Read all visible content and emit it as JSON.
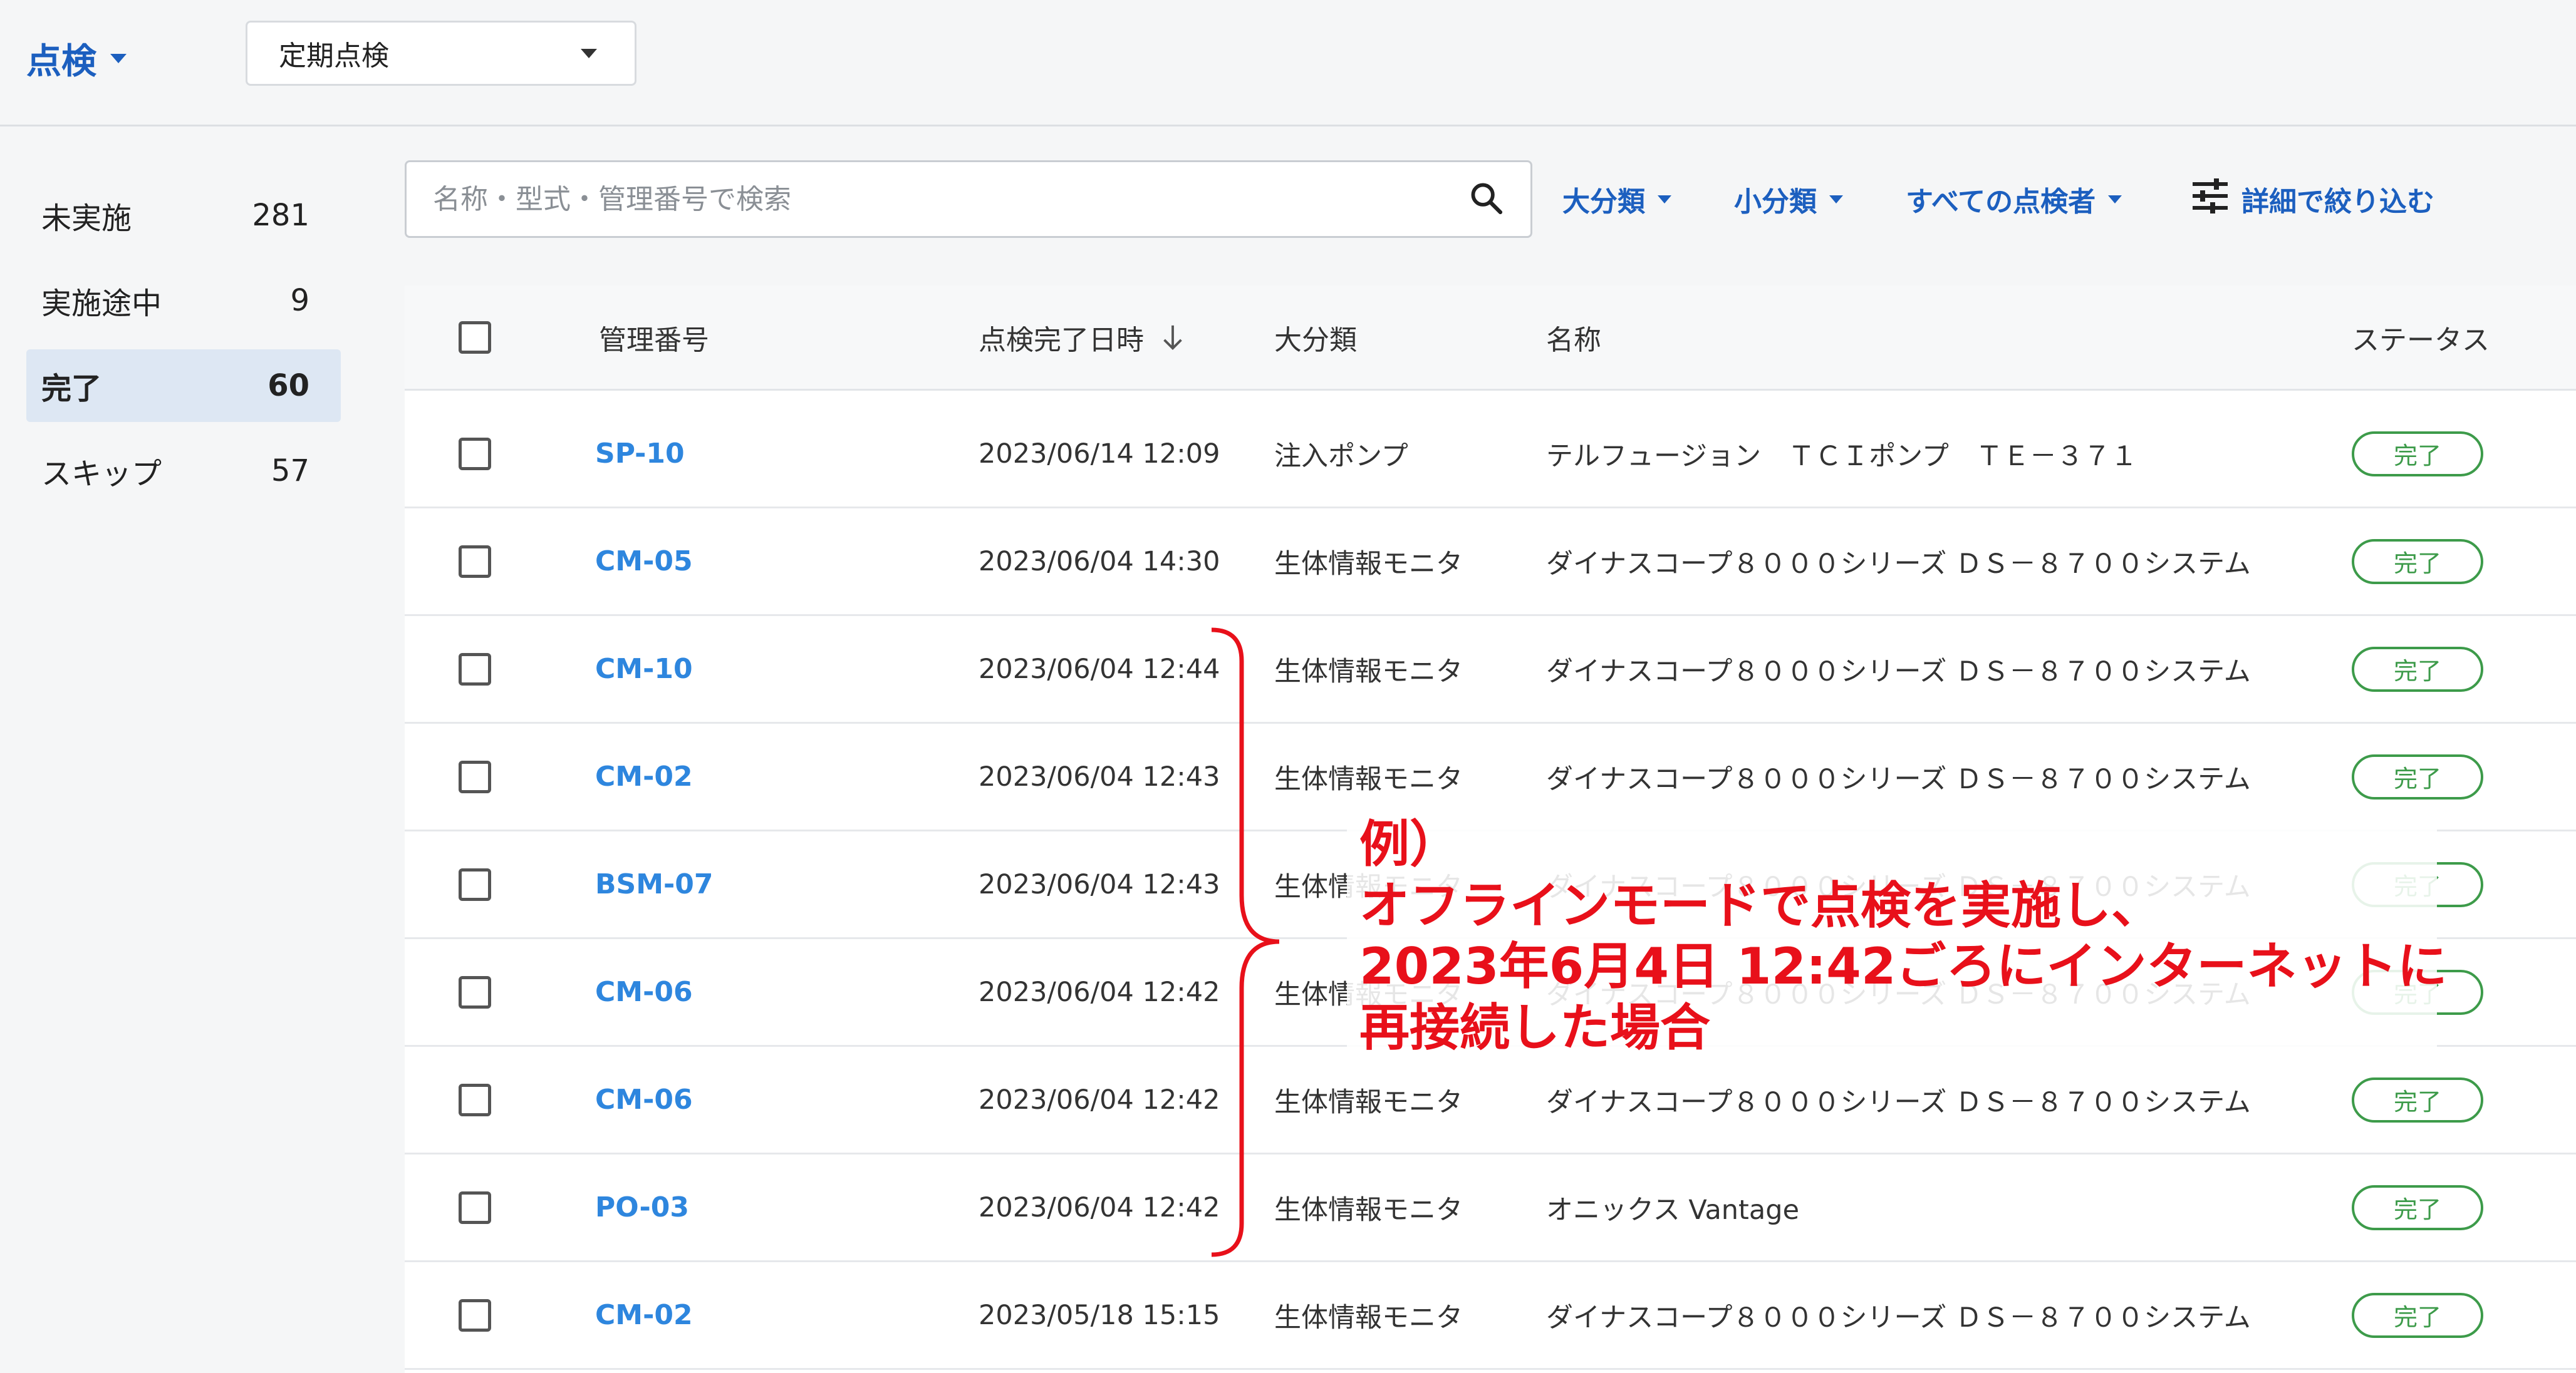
{
  "header": {
    "app_title": "点検",
    "inspection_type": "定期点検"
  },
  "sidebar": {
    "items": [
      {
        "label": "未実施",
        "count": "281",
        "active": false
      },
      {
        "label": "実施途中",
        "count": "9",
        "active": false
      },
      {
        "label": "完了",
        "count": "60",
        "active": true
      },
      {
        "label": "スキップ",
        "count": "57",
        "active": false
      }
    ]
  },
  "search": {
    "placeholder": "名称・型式・管理番号で検索",
    "icon": "search-icon"
  },
  "filters": {
    "major_category": "大分類",
    "minor_category": "小分類",
    "inspector": "すべての点検者",
    "advanced": "詳細で絞り込む",
    "advanced_icon": "tune-icon"
  },
  "table": {
    "columns": {
      "id": "管理番号",
      "completed_at": "点検完了日時",
      "category": "大分類",
      "name": "名称",
      "status": "ステータス"
    },
    "sort_icon": "arrow-down-icon",
    "rows": [
      {
        "id": "SP-10",
        "completed_at": "2023/06/14 12:09",
        "category": "注入ポンプ",
        "name": "テルフュージョン　ＴＣＩポンプ　ＴＥ－３７１",
        "status": "完了"
      },
      {
        "id": "CM-05",
        "completed_at": "2023/06/04 14:30",
        "category": "生体情報モニタ",
        "name": "ダイナスコープ８０００シリーズ ＤＳ－８７００システム",
        "status": "完了"
      },
      {
        "id": "CM-10",
        "completed_at": "2023/06/04 12:44",
        "category": "生体情報モニタ",
        "name": "ダイナスコープ８０００シリーズ ＤＳ－８７００システム",
        "status": "完了"
      },
      {
        "id": "CM-02",
        "completed_at": "2023/06/04 12:43",
        "category": "生体情報モニタ",
        "name": "ダイナスコープ８０００シリーズ ＤＳ－８７００システム",
        "status": "完了"
      },
      {
        "id": "BSM-07",
        "completed_at": "2023/06/04 12:43",
        "category": "生体情報モニタ",
        "name": "ダイナスコープ８０００シリーズ ＤＳ－８７００システム",
        "status": "完了"
      },
      {
        "id": "CM-06",
        "completed_at": "2023/06/04 12:42",
        "category": "生体情報モニタ",
        "name": "ダイナスコープ８０００シリーズ ＤＳ－８７００システム",
        "status": "完了"
      },
      {
        "id": "CM-06",
        "completed_at": "2023/06/04 12:42",
        "category": "生体情報モニタ",
        "name": "ダイナスコープ８０００シリーズ ＤＳ－８７００システム",
        "status": "完了"
      },
      {
        "id": "PO-03",
        "completed_at": "2023/06/04 12:42",
        "category": "生体情報モニタ",
        "name": "オニックス Vantage",
        "status": "完了"
      },
      {
        "id": "CM-02",
        "completed_at": "2023/05/18 15:15",
        "category": "生体情報モニタ",
        "name": "ダイナスコープ８０００シリーズ ＤＳ－８７００システム",
        "status": "完了"
      }
    ]
  },
  "annotation": {
    "lines": [
      "例）",
      "オフラインモードで点検を実施し、",
      "2023年6月4日 12:42ごろにインターネットに",
      "再接続した場合"
    ],
    "color": "#e8101a"
  },
  "colors": {
    "accent": "#1c5fbf",
    "id_link": "#2e86de",
    "status_done": "#3d9b4a"
  }
}
